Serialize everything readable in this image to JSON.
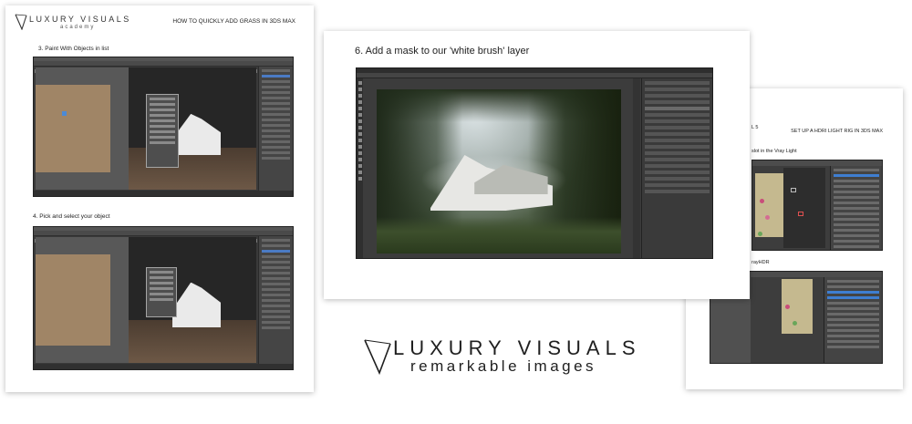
{
  "brand": {
    "name": "LUXURY VISUALS",
    "small_sub": "academy",
    "tagline": "remarkable images"
  },
  "left_page": {
    "title": "HOW TO QUICKLY ADD GRASS IN 3DS MAX",
    "step3": "3.   Paint With Objects in list",
    "step4": "4. Pick and select your object"
  },
  "center_page": {
    "title": "6. Add a mask to our 'white brush' layer"
  },
  "right_page": {
    "header_left": "L 5",
    "header_right": "SET UP A HDRI LIGHT RIG IN 3DS MAX",
    "line1": "slot in the Vray Light",
    "line2": "rayHDR"
  },
  "colors": {
    "ui_dark": "#3a3a3a",
    "max_blue": "#4b7bc4",
    "ground": "#a08566"
  }
}
